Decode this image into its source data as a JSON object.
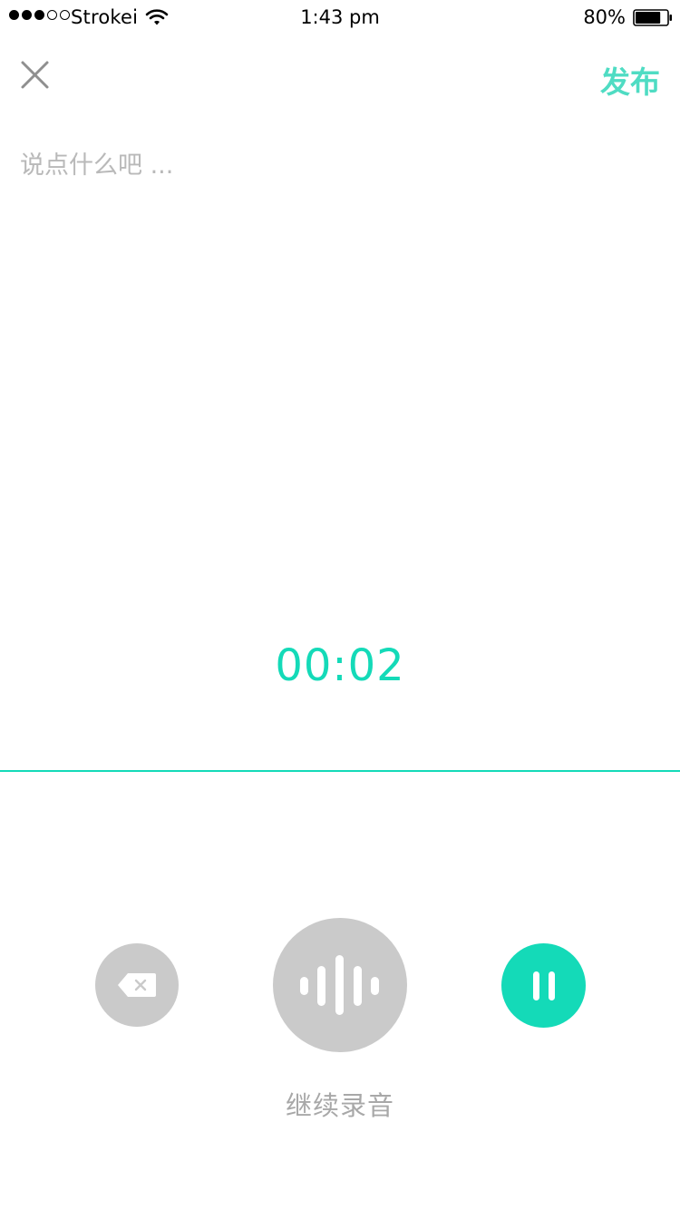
{
  "status_bar": {
    "carrier": "Strokei",
    "time": "1:43 pm",
    "battery_percent": "80%",
    "battery_level": 0.8,
    "signal_bars_filled": 3,
    "signal_bars_total": 5
  },
  "nav": {
    "close_icon": "close-x-icon",
    "publish_label": "发布"
  },
  "post": {
    "placeholder": "说点什么吧 ...",
    "value": ""
  },
  "recording": {
    "timer": "00:02",
    "continue_label": "继续录音",
    "delete_icon": "backspace-icon",
    "record_icon": "sound-wave-icon",
    "pause_icon": "pause-icon"
  },
  "colors": {
    "accent": "#14dab8",
    "publish": "#4fdcc3",
    "button_gray": "#cacaca",
    "placeholder": "#b9b9b9",
    "label_gray": "#a8a8a8"
  }
}
